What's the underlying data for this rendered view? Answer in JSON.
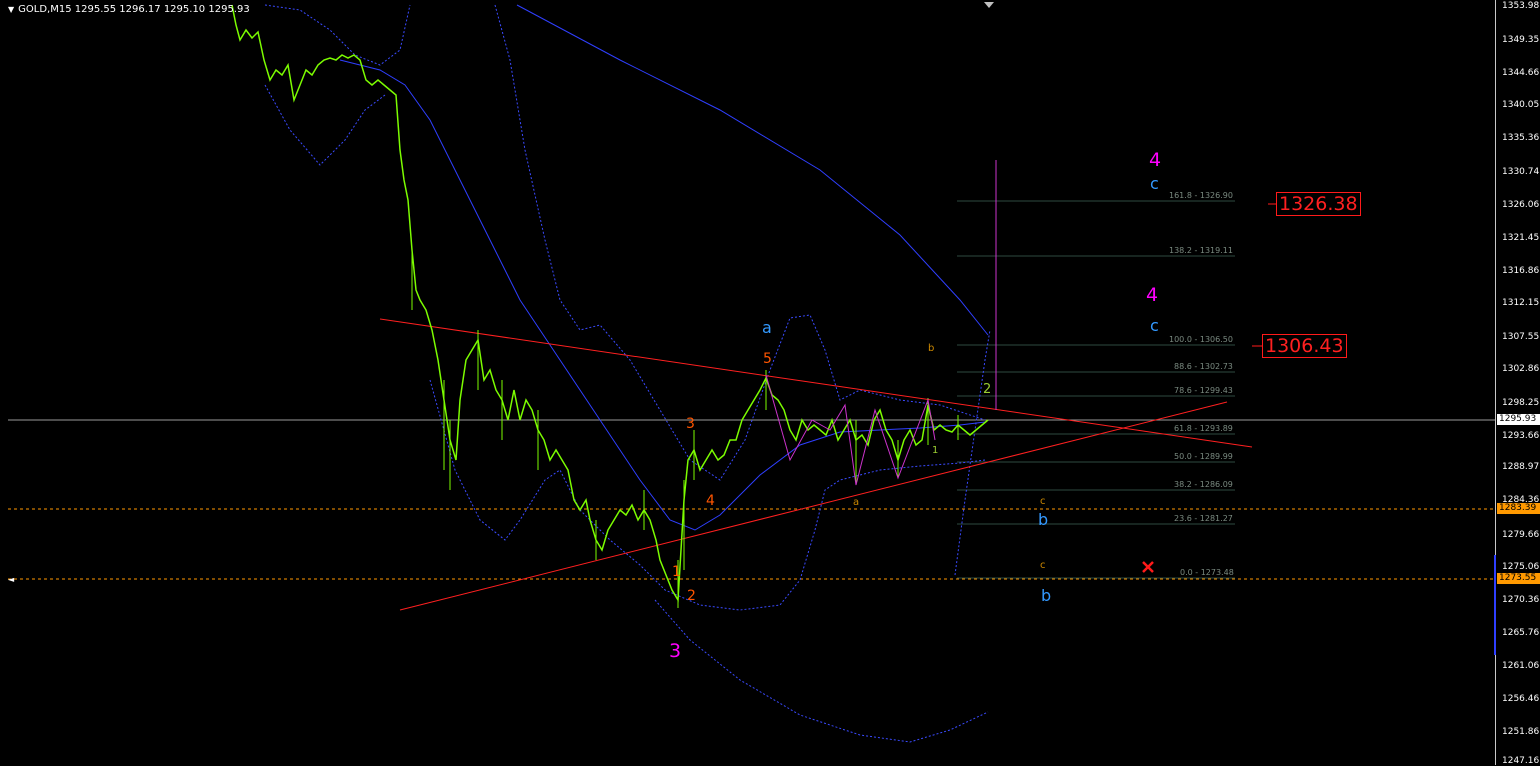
{
  "header": {
    "dropdown_icon": "triangle-down-icon",
    "symbol_info": "GOLD,M15  1295.55 1296.17 1295.10 1295.93"
  },
  "price_scale": {
    "ticks": [
      "1353.98",
      "1349.35",
      "1344.66",
      "1340.05",
      "1335.36",
      "1330.74",
      "1326.06",
      "1321.45",
      "1316.86",
      "1312.15",
      "1307.55",
      "1302.86",
      "1298.25",
      "1293.66",
      "1288.97",
      "1284.36",
      "1279.66",
      "1275.06",
      "1270.36",
      "1265.76",
      "1261.06",
      "1256.46",
      "1251.86",
      "1247.16"
    ],
    "current_price": "1295.93",
    "level_upper": "1283.39",
    "level_lower": "1273.55",
    "current_price_color": "#ffffff",
    "level_color": "#ff9900"
  },
  "targets": {
    "upper": "1326.38",
    "lower": "1306.43",
    "color": "#ff1a1a"
  },
  "fibonacci": {
    "levels": [
      "161.8 - 1326.90",
      "138.2 - 1319.11",
      "100.0 - 1306.50",
      "88.6 - 1302.73",
      "78.6 - 1299.43",
      "61.8 - 1293.89",
      "50.0 - 1289.99",
      "38.2 - 1286.09",
      "23.6 - 1281.27",
      "0.0 - 1273.48"
    ]
  },
  "wave_labels": {
    "major_3": "3",
    "major_4_upper": "4",
    "major_4_lower": "4",
    "minor_a": "a",
    "minor_b_upper": "b",
    "minor_b_lower": "b",
    "minor_c_upper": "c",
    "minor_c_lower": "c",
    "sub_1": "1",
    "sub_2": "2",
    "sub_3": "3",
    "sub_4": "4",
    "sub_5": "5",
    "small_a": "a",
    "small_b": "b",
    "small_c_upper": "c",
    "small_c_lower": "c",
    "small_1": "1",
    "small_2": "2"
  },
  "markers": {
    "invalidation_icon": "x-cross-icon"
  },
  "colors": {
    "background": "#000000",
    "candles": "#7cfc00",
    "trendline": "#ff2020",
    "moving_average": "#2f3fff",
    "bands": "#3a4aff",
    "zigzag": "#cc33cc",
    "magenta_wave": "#ff00ff",
    "blue_wave": "#3399ff",
    "orange_wave": "#ff6a00"
  }
}
